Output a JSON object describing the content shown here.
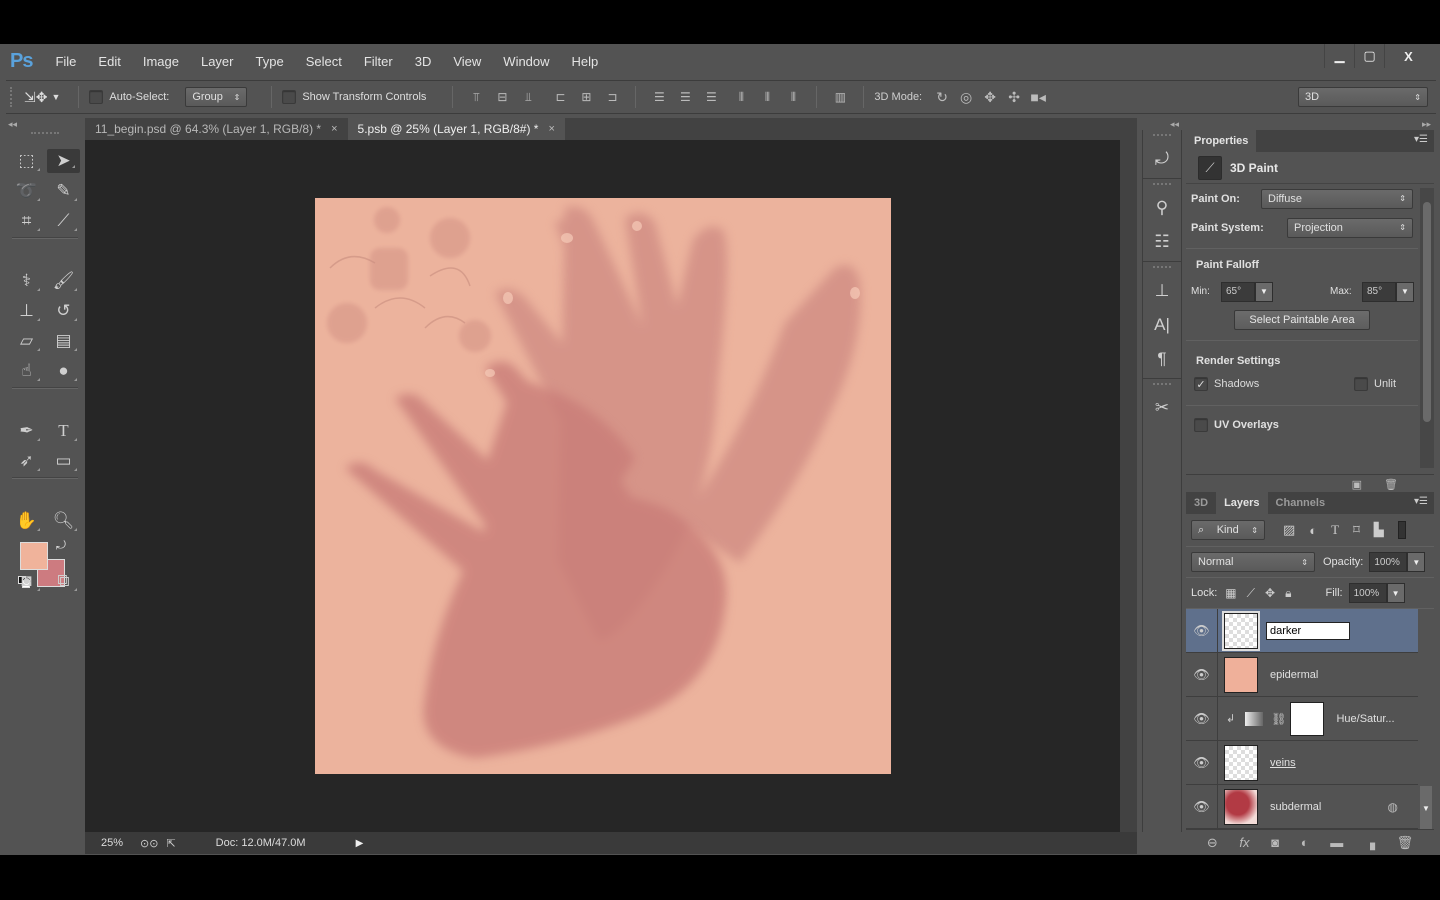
{
  "app": {
    "logo": "Ps",
    "menu": [
      "File",
      "Edit",
      "Image",
      "Layer",
      "Type",
      "Select",
      "Filter",
      "3D",
      "View",
      "Window",
      "Help"
    ],
    "window_controls": {
      "minimize": "▁",
      "maximize": "▢",
      "close": "X"
    }
  },
  "options_bar": {
    "tool_icon": "move-tool",
    "auto_select_label": "Auto-Select:",
    "auto_select_checked": false,
    "auto_select_target": "Group",
    "show_transform_label": "Show Transform Controls",
    "show_transform_checked": false,
    "mode3d_label": "3D Mode:",
    "workspace": "3D"
  },
  "tabs": [
    {
      "label": "11_begin.psd @ 64.3% (Layer 1, RGB/8) *",
      "active": false,
      "close": "×"
    },
    {
      "label": "5.psb @ 25% (Layer 1, RGB/8#) *",
      "active": true,
      "close": "×"
    }
  ],
  "tools": {
    "foreground_color": "#f0b39b",
    "background_color": "#cd7b80",
    "swap_glyph": "⤾"
  },
  "status": {
    "zoom": "25%",
    "doc": "Doc: 12.0M/47.0M",
    "play": "▶"
  },
  "properties": {
    "tab": "Properties",
    "head_title": "3D Paint",
    "paint_on_label": "Paint On:",
    "paint_on_value": "Diffuse",
    "paint_system_label": "Paint System:",
    "paint_system_value": "Projection",
    "falloff_title": "Paint Falloff",
    "min_label": "Min:",
    "min_value": "65°",
    "max_label": "Max:",
    "max_value": "85°",
    "select_area_button": "Select Paintable Area",
    "render_title": "Render Settings",
    "shadows_label": "Shadows",
    "shadows_checked": true,
    "unlit_label": "Unlit",
    "unlit_checked": false,
    "uv_overlays_label": "UV Overlays",
    "uv_overlays_checked": false
  },
  "layers_panel": {
    "tabs": [
      "3D",
      "Layers",
      "Channels"
    ],
    "active_tab": "Layers",
    "filter_kind": "Kind",
    "blend_mode": "Normal",
    "opacity_label": "Opacity:",
    "opacity_value": "100%",
    "lock_label": "Lock:",
    "fill_label": "Fill:",
    "fill_value": "100%",
    "layers": [
      {
        "name": "darker",
        "editing": true,
        "selected": true,
        "visible": true,
        "thumb": "transparent"
      },
      {
        "name": "epidermal",
        "editing": false,
        "selected": false,
        "visible": true,
        "thumb": "#efb09a"
      },
      {
        "name": "Hue/Satur...",
        "editing": false,
        "selected": false,
        "visible": true,
        "thumb": "adjustment",
        "clipped": true
      },
      {
        "name": "veins",
        "editing": false,
        "selected": false,
        "visible": true,
        "thumb": "transparent"
      },
      {
        "name": "subdermal",
        "editing": false,
        "selected": false,
        "visible": true,
        "thumb": "#b23a44",
        "smart_object": true
      }
    ]
  }
}
